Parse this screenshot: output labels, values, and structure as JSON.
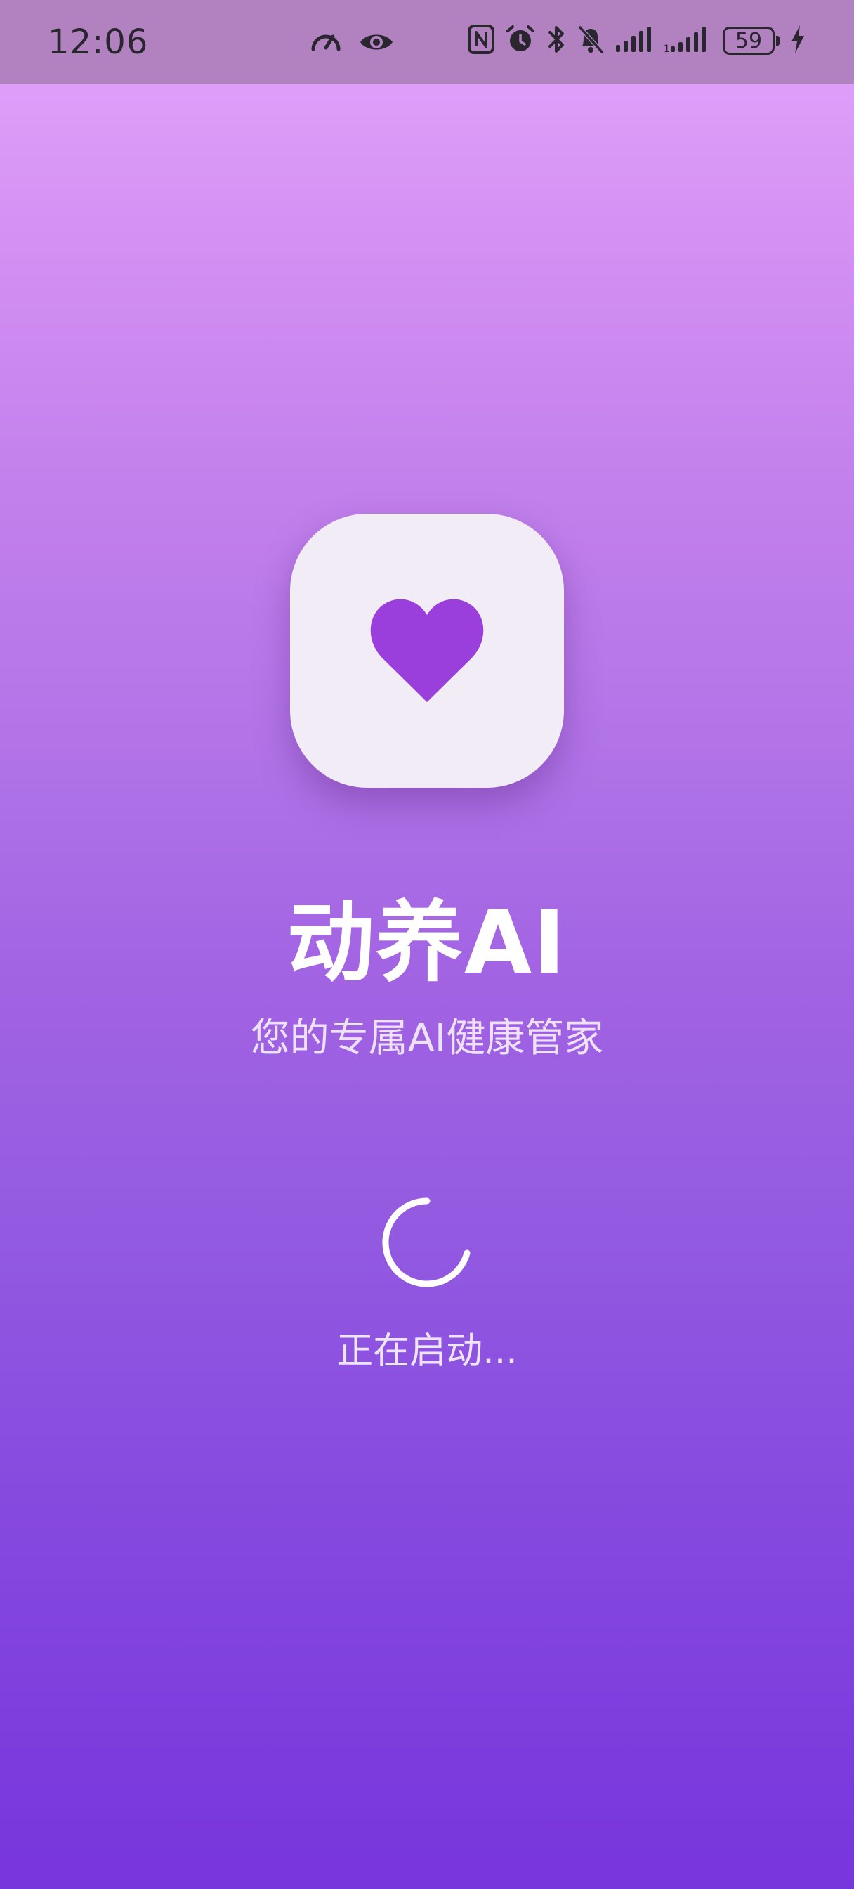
{
  "status_bar": {
    "time": "12:06",
    "battery_level": "59",
    "icons": [
      "speed-icon",
      "eye-icon",
      "nfc-icon",
      "alarm-icon",
      "bluetooth-icon",
      "bell-off-icon",
      "signal-icon",
      "signal-icon",
      "battery-icon",
      "charging-icon"
    ]
  },
  "splash": {
    "app_icon": "heart-icon",
    "heart_color": "#9b3fdc",
    "app_name": "动养AI",
    "tagline": "您的专属AI健康管家",
    "loading_text": "正在启动..."
  },
  "colors": {
    "gradient_top": "#e3a6fb",
    "gradient_bottom": "#7735dc",
    "status_bar_bg": "#b282c0"
  }
}
